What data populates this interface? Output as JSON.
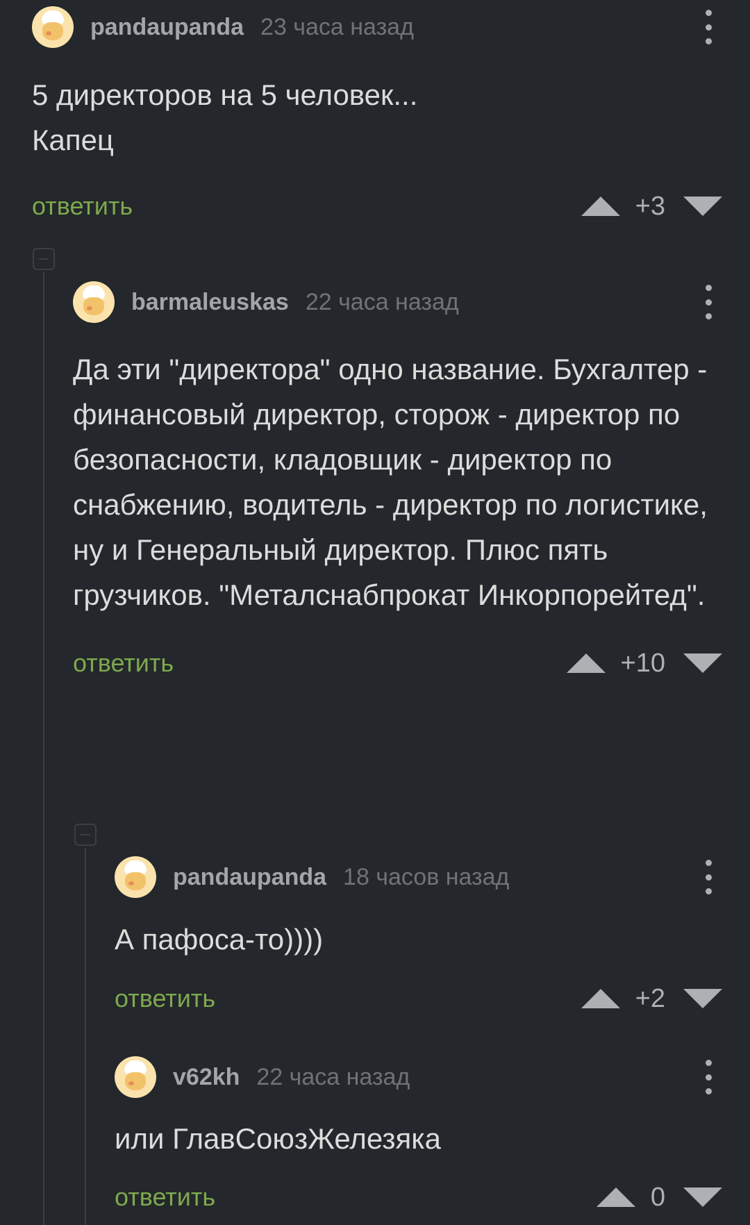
{
  "comments": [
    {
      "username": "pandaupanda",
      "time": "23 часа назад",
      "text": "5 директоров на 5 человек...\nКапец",
      "reply_label": "ответить",
      "score": "+3"
    },
    {
      "username": "barmaleuskas",
      "time": "22 часа назад",
      "text": "Да эти \"директора\" одно название. Бухгалтер - финансовый директор, сторож - директор по безопасности, кладовщик - директор по снабжению, водитель - директор по логистике, ну и Генеральный директор. Плюс пять грузчиков. \"Металснабпрокат Инкорпорейтед\".",
      "reply_label": "ответить",
      "score": "+10"
    },
    {
      "username": "pandaupanda",
      "time": "18 часов назад",
      "text": "А пафоса-то))))",
      "reply_label": "ответить",
      "score": "+2"
    },
    {
      "username": "v62kh",
      "time": "22 часа назад",
      "text": "или ГлавСоюзЖелезяка",
      "reply_label": "ответить",
      "score": "0"
    }
  ],
  "colors": {
    "background": "#24272b",
    "reply_link": "#7da94e",
    "username": "#a3a6a9",
    "timestamp": "#6f7378",
    "body_text": "#dcdcdc",
    "thread_line": "#3b3f44"
  }
}
